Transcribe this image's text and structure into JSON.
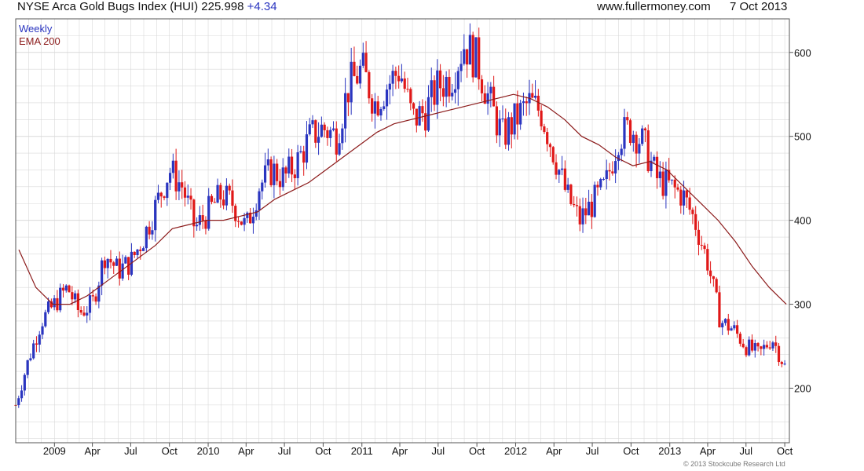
{
  "header": {
    "title": "NYSE Arca Gold Bugs Index (HUI) 225.998",
    "change": "+4.34",
    "site": "www.fullermoney.com",
    "date": "7 Oct 2013"
  },
  "legend": {
    "series1": "Weekly",
    "series2": "EMA 200"
  },
  "copyright": "© 2013 Stockcube Research Ltd",
  "colors": {
    "up": "#2a35c0",
    "down": "#e01818",
    "ema": "#8b1a1a",
    "grid": "#d9d9d9",
    "frame": "#555555"
  },
  "chart_data": {
    "type": "line",
    "title": "NYSE Arca Gold Bugs Index (HUI) 225.998",
    "xlabel": "",
    "ylabel": "",
    "ylim": [
      135,
      640
    ],
    "y_ticks": [
      200,
      300,
      400,
      500,
      600
    ],
    "x_ticks": [
      "2009",
      "Apr",
      "Jul",
      "Oct",
      "2010",
      "Apr",
      "Jul",
      "Oct",
      "2011",
      "Apr",
      "Jul",
      "Oct",
      "2012",
      "Apr",
      "Jul",
      "Oct",
      "2013",
      "Apr",
      "Jul",
      "Oct"
    ],
    "grid": true,
    "legend_position": "top-left",
    "x": [
      "2008-10",
      "2008-11",
      "2008-12",
      "2009-01",
      "2009-02",
      "2009-03",
      "2009-04",
      "2009-05",
      "2009-06",
      "2009-07",
      "2009-08",
      "2009-09",
      "2009-10",
      "2009-11",
      "2009-12",
      "2010-01",
      "2010-02",
      "2010-03",
      "2010-04",
      "2010-05",
      "2010-06",
      "2010-07",
      "2010-08",
      "2010-09",
      "2010-10",
      "2010-11",
      "2010-12",
      "2011-01",
      "2011-02",
      "2011-03",
      "2011-04",
      "2011-05",
      "2011-06",
      "2011-07",
      "2011-08",
      "2011-09",
      "2011-10",
      "2011-11",
      "2011-12",
      "2012-01",
      "2012-02",
      "2012-03",
      "2012-04",
      "2012-05",
      "2012-06",
      "2012-07",
      "2012-08",
      "2012-09",
      "2012-10",
      "2012-11",
      "2012-12",
      "2013-01",
      "2013-02",
      "2013-03",
      "2013-04",
      "2013-05",
      "2013-06",
      "2013-07",
      "2013-08",
      "2013-09",
      "2013-10"
    ],
    "series": [
      {
        "name": "Weekly",
        "values": [
          180,
          235,
          280,
          300,
          320,
          290,
          300,
          360,
          340,
          350,
          380,
          420,
          460,
          440,
          390,
          410,
          430,
          420,
          390,
          440,
          460,
          450,
          470,
          500,
          510,
          500,
          560,
          580,
          540,
          560,
          580,
          520,
          530,
          560,
          570,
          610,
          590,
          540,
          500,
          520,
          540,
          530,
          480,
          430,
          400,
          420,
          440,
          500,
          510,
          490,
          450,
          440,
          430,
          400,
          350,
          280,
          270,
          250,
          240,
          260,
          226
        ]
      },
      {
        "name": "EMA 200",
        "values": [
          365,
          320,
          300,
          300,
          310,
          325,
          340,
          355,
          370,
          390,
          395,
          400,
          400,
          405,
          410,
          425,
          435,
          445,
          460,
          475,
          490,
          505,
          515,
          520,
          525,
          530,
          535,
          540,
          545,
          550,
          545,
          535,
          520,
          500,
          490,
          475,
          465,
          470,
          460,
          440,
          420,
          400,
          375,
          345,
          320,
          300
        ]
      }
    ]
  }
}
